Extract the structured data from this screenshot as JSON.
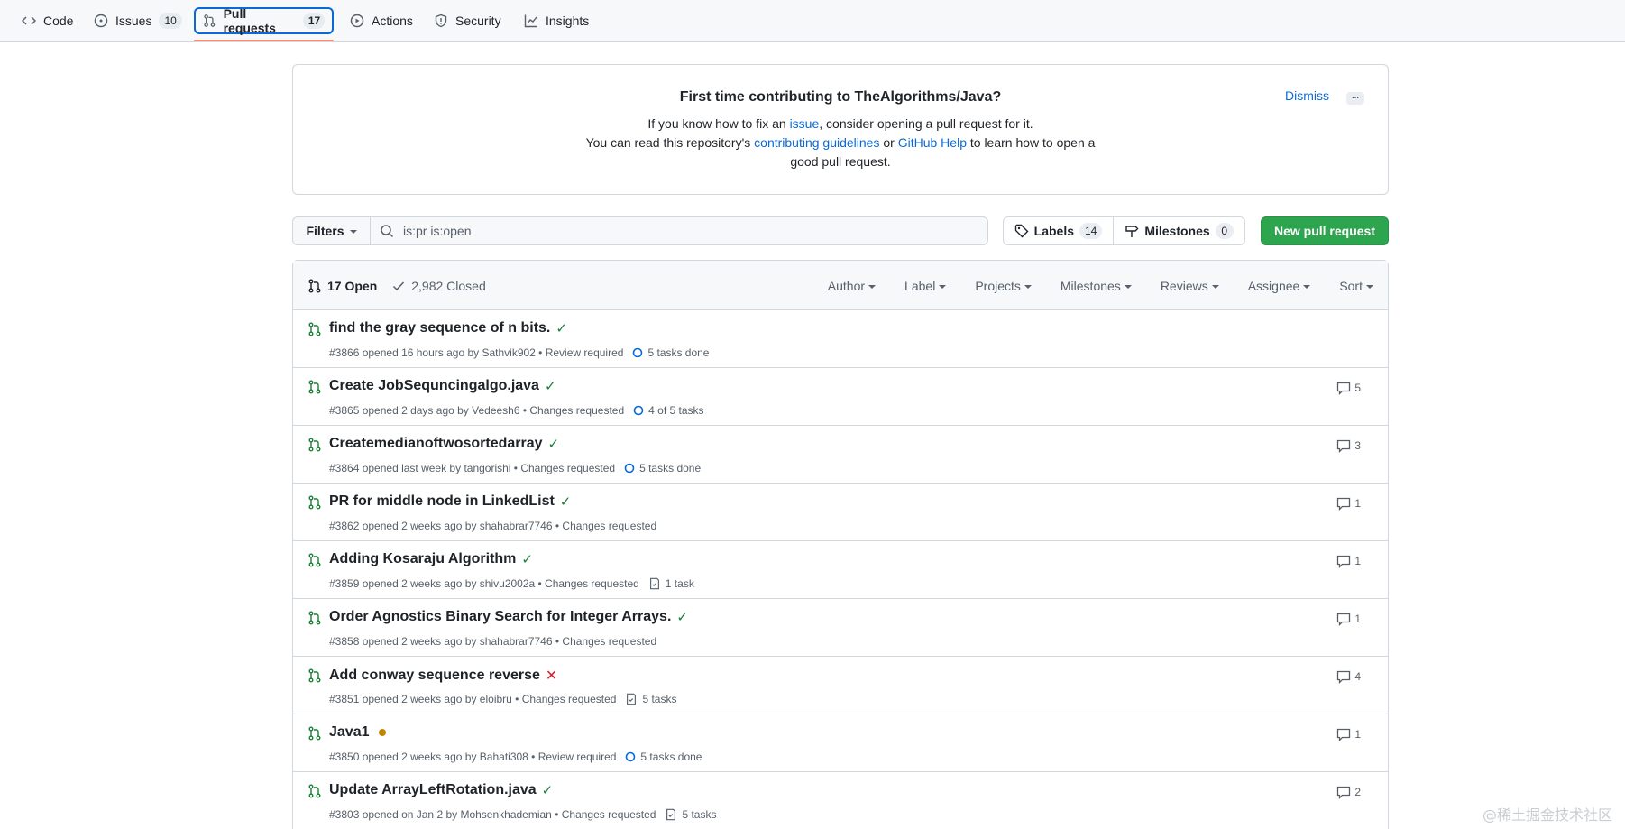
{
  "repo_nav": {
    "tabs": [
      {
        "label": "Code",
        "icon": "code-icon"
      },
      {
        "label": "Issues",
        "count": "10",
        "icon": "issue-opened-icon"
      },
      {
        "label": "Pull requests",
        "count": "17",
        "icon": "git-pull-request-icon",
        "selected": true
      },
      {
        "label": "Actions",
        "icon": "play-icon"
      },
      {
        "label": "Security",
        "icon": "shield-icon"
      },
      {
        "label": "Insights",
        "icon": "graph-icon"
      }
    ]
  },
  "banner": {
    "title": "First time contributing to TheAlgorithms/Java?",
    "line1_pre": "If you know how to fix an ",
    "line1_link": "issue",
    "line1_post": ", consider opening a pull request for it.",
    "line2_pre": "You can read this repository's ",
    "line2_link1": "contributing guidelines",
    "line2_mid": " or ",
    "line2_link2": "GitHub Help",
    "line2_post": " to learn how to open a",
    "line3": "good pull request.",
    "dismiss": "Dismiss",
    "more": "..."
  },
  "toolbar": {
    "filters": "Filters",
    "search_value": "is:pr is:open",
    "labels": "Labels",
    "labels_count": "14",
    "milestones": "Milestones",
    "milestones_count": "0",
    "new_pr": "New pull request"
  },
  "list_header": {
    "open": "17 Open",
    "closed": "2,982 Closed",
    "menus": [
      "Author",
      "Label",
      "Projects",
      "Milestones",
      "Reviews",
      "Assignee",
      "Sort"
    ]
  },
  "pull_requests": [
    {
      "title": "find the gray sequence of n bits.",
      "status": "success",
      "meta": "#3866 opened 16 hours ago by Sathvik902 • Review required",
      "task": "5 tasks done",
      "task_icon": "circle-progress-icon",
      "comments": ""
    },
    {
      "title": "Create JobSequncingalgo.java",
      "status": "success",
      "meta": "#3865 opened 2 days ago by Vedeesh6 • Changes requested",
      "task": "4 of 5 tasks",
      "task_icon": "circle-progress-icon",
      "comments": "5"
    },
    {
      "title": "Createmedianoftwosortedarray",
      "status": "success",
      "meta": "#3864 opened last week by tangorishi • Changes requested",
      "task": "5 tasks done",
      "task_icon": "circle-progress-icon",
      "comments": "3"
    },
    {
      "title": "PR for middle node in LinkedList",
      "status": "success",
      "meta": "#3862 opened 2 weeks ago by shahabrar7746 • Changes requested",
      "task": "",
      "task_icon": "",
      "comments": "1"
    },
    {
      "title": "Adding Kosaraju Algorithm",
      "status": "success",
      "meta": "#3859 opened 2 weeks ago by shivu2002a • Changes requested",
      "task": "1 task",
      "task_icon": "checklist-icon",
      "comments": "1"
    },
    {
      "title": "Order Agnostics Binary Search for Integer Arrays.",
      "status": "success",
      "meta": "#3858 opened 2 weeks ago by shahabrar7746 • Changes requested",
      "task": "",
      "task_icon": "",
      "comments": "1"
    },
    {
      "title": "Add conway sequence reverse",
      "status": "failure",
      "meta": "#3851 opened 2 weeks ago by eloibru • Changes requested",
      "task": "5 tasks",
      "task_icon": "checklist-icon",
      "comments": "4"
    },
    {
      "title": "Java1",
      "status": "pending",
      "meta": "#3850 opened 2 weeks ago by Bahati308 • Review required",
      "task": "5 tasks done",
      "task_icon": "circle-progress-icon",
      "comments": "1"
    },
    {
      "title": "Update ArrayLeftRotation.java",
      "status": "success",
      "meta": "#3803 opened on Jan 2 by Mohsenkhademian • Changes requested",
      "task": "5 tasks",
      "task_icon": "checklist-icon",
      "comments": "2"
    }
  ],
  "colors": {
    "accent": "#0969da",
    "success": "#1a7f37",
    "failure": "#cf222e",
    "pending": "#bf8700",
    "primary_button": "#2da44e"
  },
  "watermark": "@稀土掘金技术社区"
}
